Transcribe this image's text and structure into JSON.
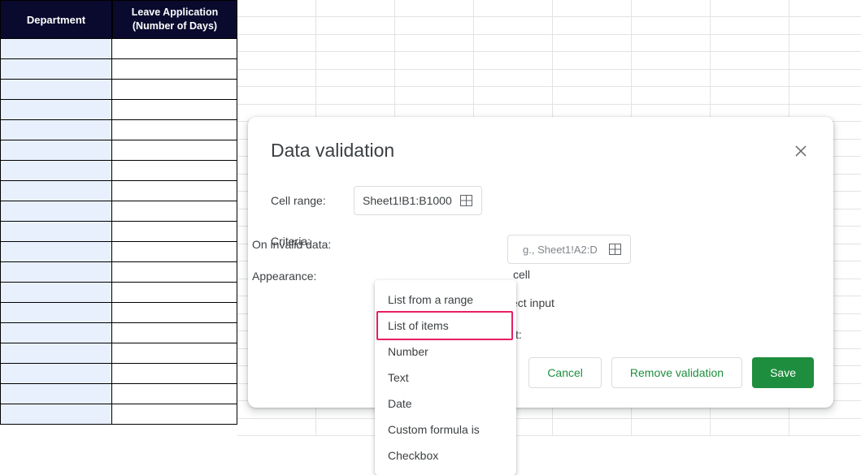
{
  "table": {
    "headers": [
      "Department",
      "Leave Application\n(Number of Days)"
    ]
  },
  "dialog": {
    "title": "Data validation",
    "fields": {
      "cell_range": {
        "label": "Cell range:",
        "value": "Sheet1!B1:B1000"
      },
      "criteria": {
        "label": "Criteria:",
        "placeholder": "g., Sheet1!A2:D",
        "cell_text": "cell",
        "ect_text": "ect input",
        "t_colon": "t:"
      },
      "on_invalid": {
        "label": "On invalid data:"
      },
      "appearance": {
        "label": "Appearance:"
      }
    },
    "dropdown": {
      "items": [
        "List from a range",
        "List of items",
        "Number",
        "Text",
        "Date",
        "Custom formula is",
        "Checkbox"
      ]
    },
    "buttons": {
      "cancel": "Cancel",
      "remove": "Remove validation",
      "save": "Save"
    }
  }
}
